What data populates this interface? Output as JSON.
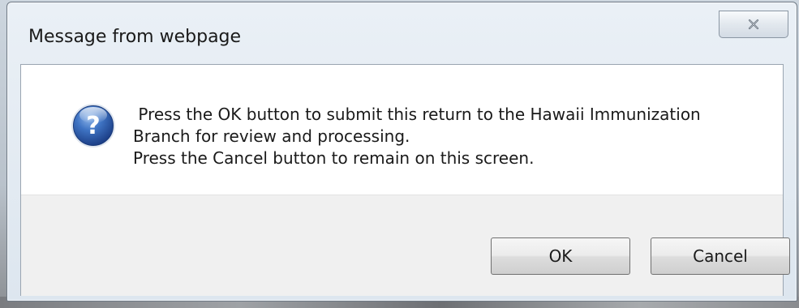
{
  "dialog": {
    "title": "Message from webpage",
    "close_glyph": "✕",
    "icon": "question-icon",
    "message_lines": [
      " Press the OK button to submit this return to the Hawaii Immunization",
      "Branch for review and processing.",
      "Press the Cancel button to remain on this screen."
    ],
    "buttons": {
      "ok_label": "OK",
      "cancel_label": "Cancel"
    }
  },
  "colors": {
    "icon_blue": "#2f62b8",
    "titlebar": "#dde6ef",
    "footer": "#f0f0f0"
  }
}
